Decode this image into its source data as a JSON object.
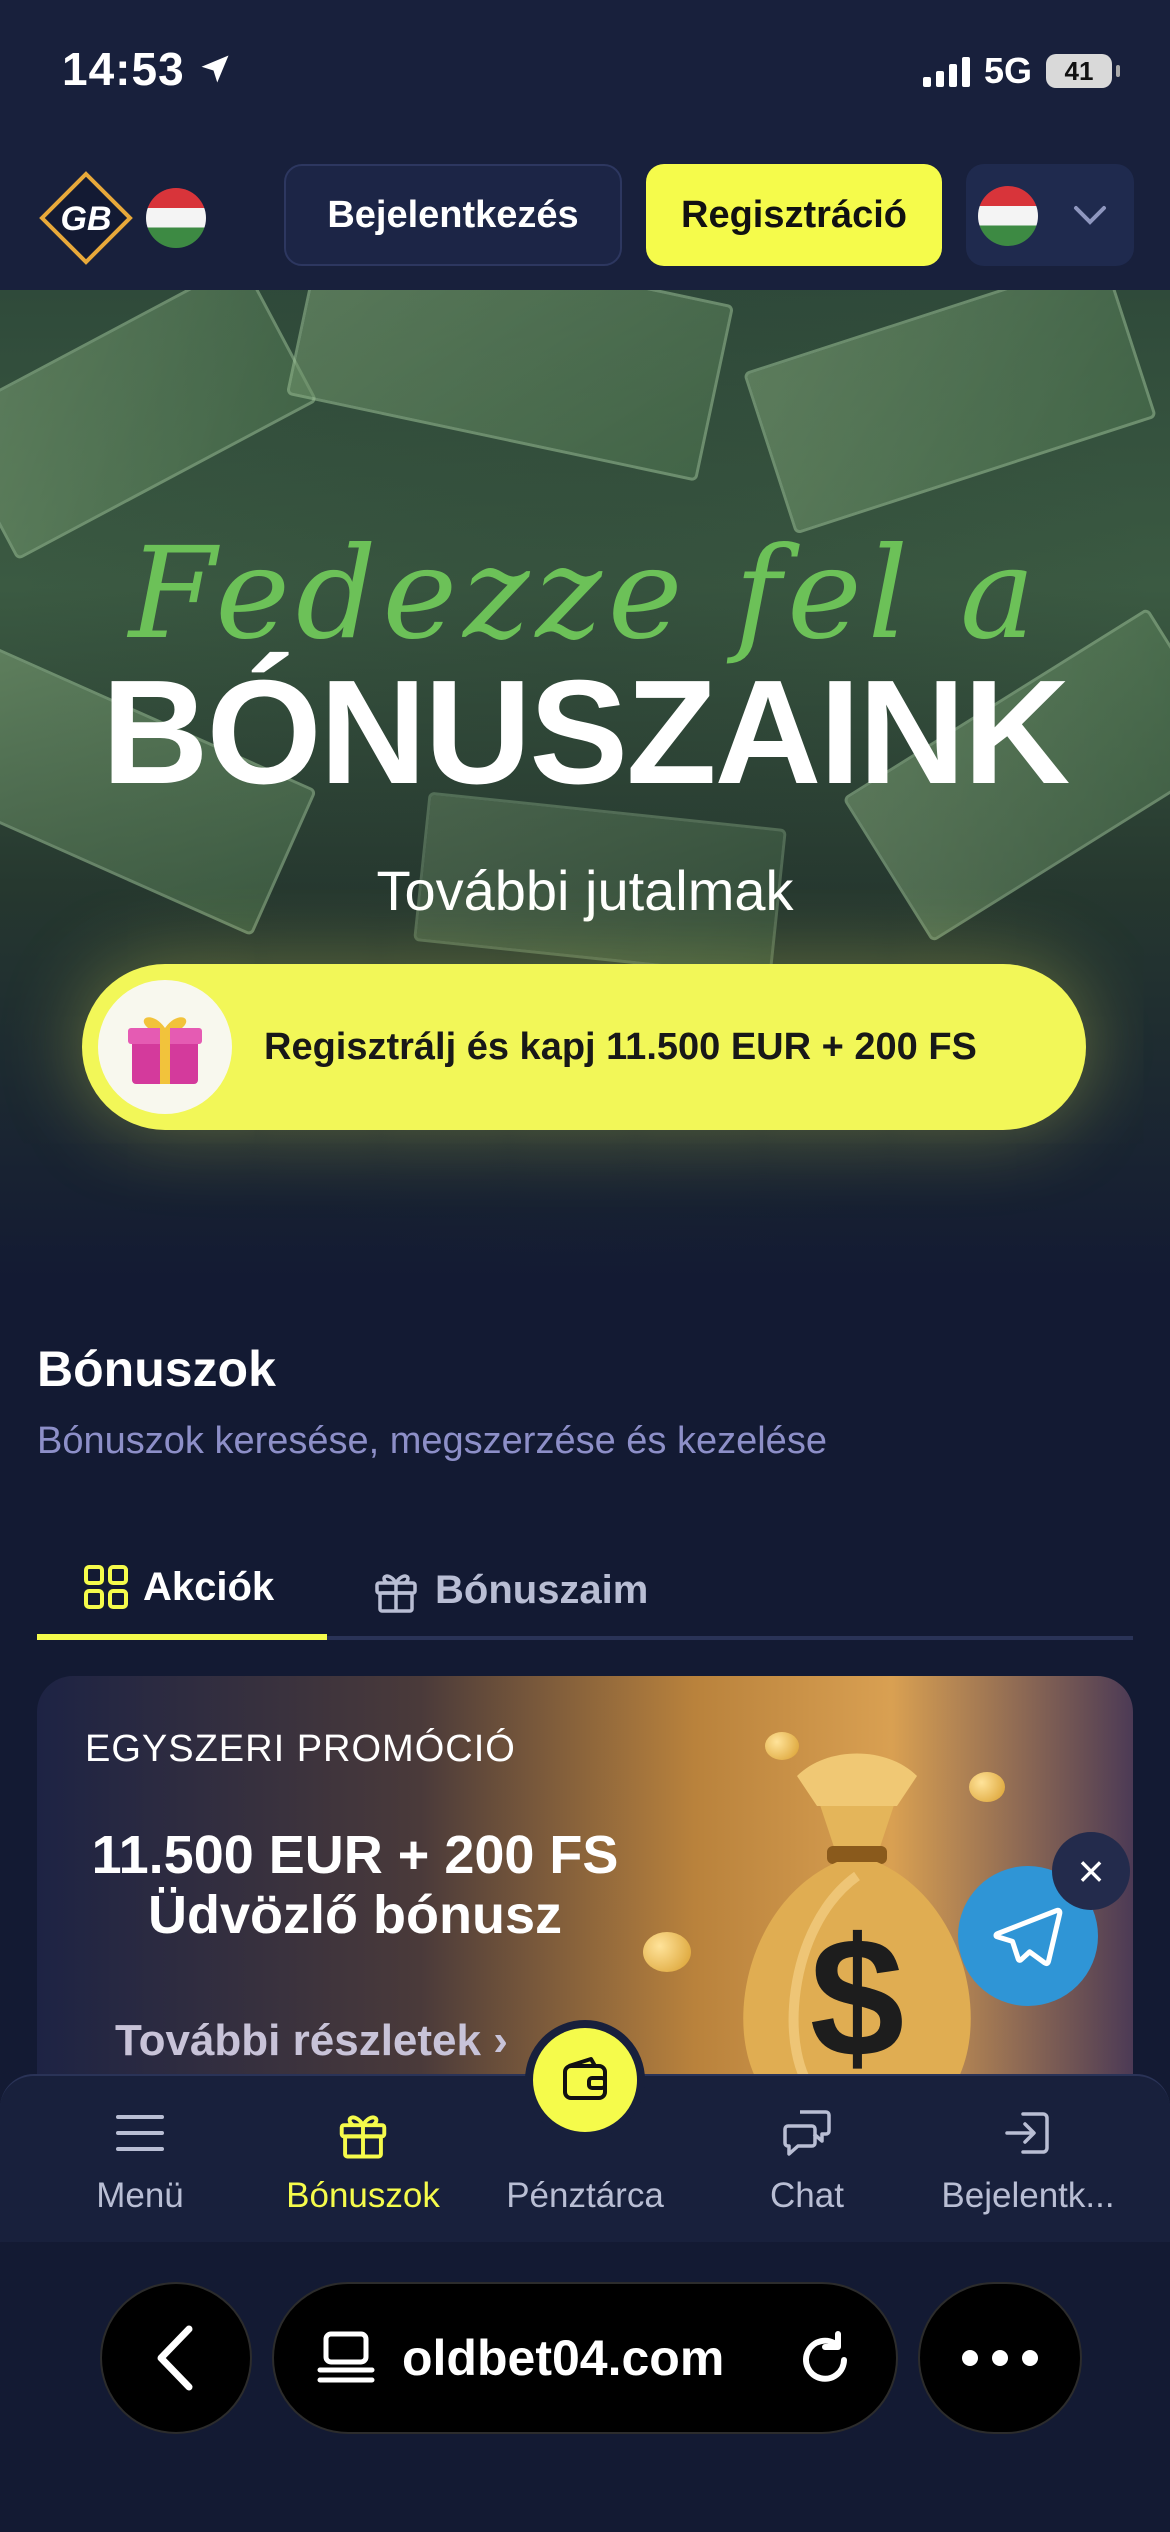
{
  "status_bar": {
    "time": "14:53",
    "network": "5G",
    "battery": "41"
  },
  "header": {
    "logo_text": "GB",
    "login_label": "Bejelentkezés",
    "register_label": "Regisztráció"
  },
  "hero": {
    "script_text": "Fedezze fel a",
    "title": "BÓNUSZAINK",
    "subtitle": "További jutalmak",
    "promo_text": "Regisztrálj és kapj 11.500 EUR + 200 FS"
  },
  "bonus_section": {
    "title": "Bónuszok",
    "subtitle": "Bónuszok keresése, megszerzése és kezelése",
    "tabs": [
      {
        "label": "Akciók",
        "icon": "grid-icon",
        "active": true
      },
      {
        "label": "Bónuszaim",
        "icon": "gift-icon",
        "active": false
      }
    ]
  },
  "promo_card": {
    "label": "EGYSZERI PROMÓCIÓ",
    "amount": "11.500 EUR + 200 FS",
    "name": "Üdvözlő bónusz",
    "more_label": "További részletek",
    "symbol": "$"
  },
  "bottom_nav": {
    "items": [
      {
        "label": "Menü",
        "icon": "menu-icon",
        "active": false
      },
      {
        "label": "Bónuszok",
        "icon": "gift-icon",
        "active": true
      },
      {
        "label": "Pénztárca",
        "icon": "wallet-icon",
        "active": false
      },
      {
        "label": "Chat",
        "icon": "chat-icon",
        "active": false
      },
      {
        "label": "Bejelentk...",
        "icon": "login-icon",
        "active": false
      }
    ]
  },
  "browser": {
    "url": "oldbet04.com"
  },
  "colors": {
    "accent": "#f5fb4b",
    "background": "#131a33",
    "script_green": "#6cc158",
    "telegram": "#2f95d6"
  }
}
